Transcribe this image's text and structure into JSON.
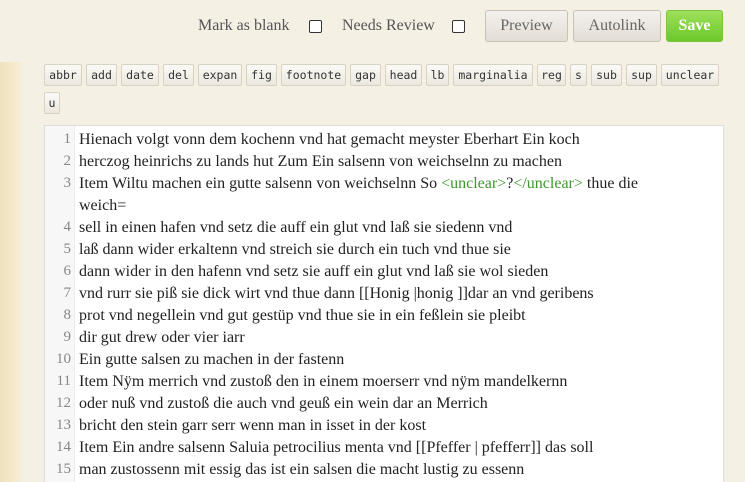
{
  "toolbar": {
    "mark_blank_label": "Mark as blank",
    "needs_review_label": "Needs Review",
    "preview_label": "Preview",
    "autolink_label": "Autolink",
    "save_label": "Save"
  },
  "tags": [
    "abbr",
    "add",
    "date",
    "del",
    "expan",
    "fig",
    "footnote",
    "gap",
    "head",
    "lb",
    "marginalia",
    "reg",
    "s",
    "sub",
    "sup",
    "unclear",
    "u"
  ],
  "lines": [
    {
      "num": "1",
      "text": "Hienach volgt vonn dem kochenn vnd hat gemacht meyster Eberhart Ein koch"
    },
    {
      "num": "2",
      "text": "herczog heinrichs zu lands hut Zum Ein salsenn von weichselnn zu machen"
    },
    {
      "num": "3",
      "pre": "Item Wiltu machen ein gutte salsenn von weichselnn So ",
      "open": "<unclear>",
      "mid": "?",
      "close": "</unclear>",
      "post": " thue die",
      "cont": "weich="
    },
    {
      "num": "4",
      "text": "sell in einen hafen vnd setz die auff ein glut vnd laß sie siedenn vnd"
    },
    {
      "num": "5",
      "text": "laß dann wider erkaltenn vnd streich sie durch ein tuch vnd thue sie"
    },
    {
      "num": "6",
      "text": "dann wider in den hafenn vnd setz sie auff ein glut vnd laß sie wol sieden"
    },
    {
      "num": "7",
      "text": "vnd rurr sie piß sie dick wirt vnd thue dann [[Honig |honig ]]dar an vnd geribens"
    },
    {
      "num": "8",
      "text": "prot vnd negellein vnd gut gestüp vnd thue sie in ein feßlein sie pleibt"
    },
    {
      "num": "9",
      "text": "dir gut drew oder vier iarr"
    },
    {
      "num": "10",
      "text": "Ein gutte salsen zu machen in der fastenn"
    },
    {
      "num": "11",
      "text": "Item Nÿm merrich vnd zustoß den in einem moerserr vnd nÿm mandelkernn"
    },
    {
      "num": "12",
      "text": "oder nuß vnd zustoß die auch vnd geuß ein wein dar an Merrich"
    },
    {
      "num": "13",
      "text": "bricht den stein garr serr wenn man in isset in der kost"
    },
    {
      "num": "14",
      "text": "Item Ein andre salsenn Saluia petrocilius menta vnd [[Pfeffer | pfefferr]] das soll"
    },
    {
      "num": "15",
      "text": "man zustossenn mit essig das ist ein salsen die macht lustig zu essenn"
    }
  ]
}
